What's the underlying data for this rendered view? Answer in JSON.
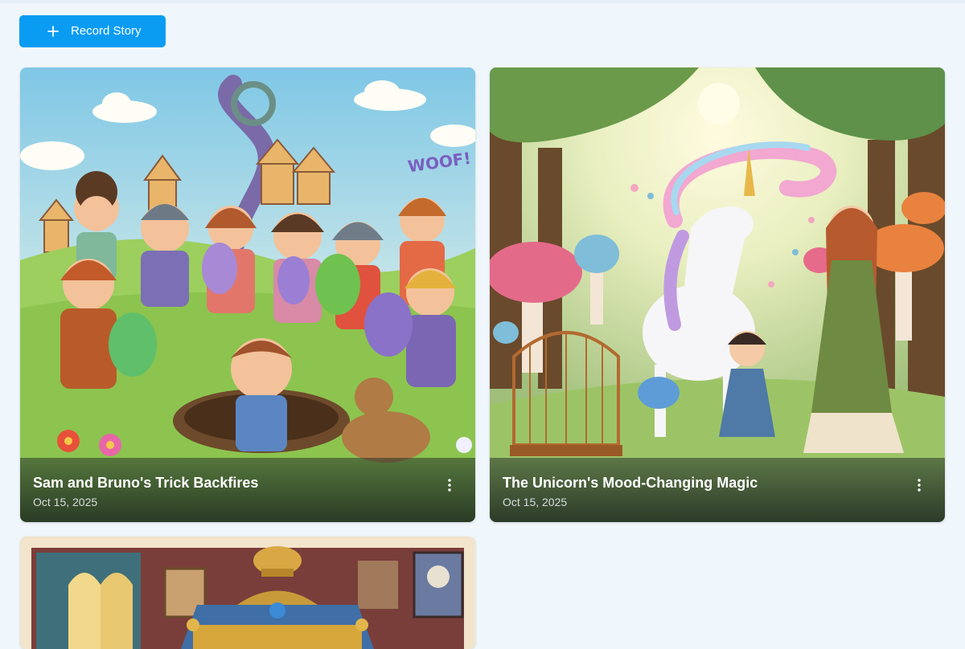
{
  "toolbar": {
    "record_label": "Record Story",
    "record_icon": "plus-icon"
  },
  "stories": [
    {
      "title": "Sam and Bruno's Trick Backfires",
      "date": "Oct 15, 2025",
      "menu_icon": "more-vertical-icon"
    },
    {
      "title": "The Unicorn's Mood-Changing Magic",
      "date": "Oct 15, 2025",
      "menu_icon": "more-vertical-icon"
    },
    {
      "title": "",
      "date": ""
    }
  ],
  "illustration_text": {
    "woof": "WOOF!"
  },
  "colors": {
    "accent": "#0a9cf2",
    "page_bg": "#f0f7fc"
  }
}
